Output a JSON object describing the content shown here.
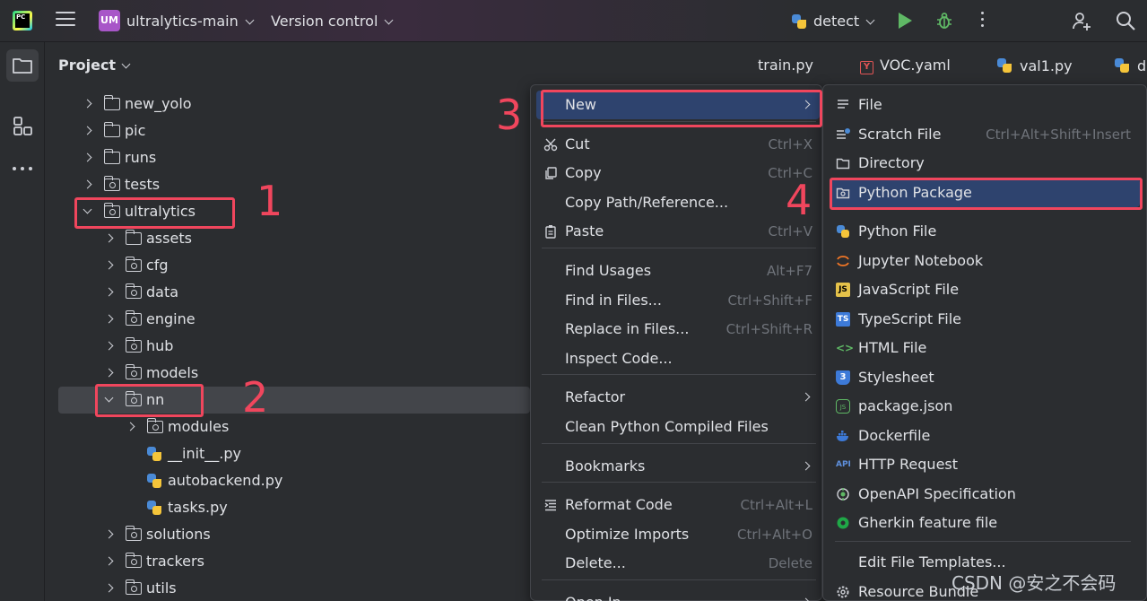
{
  "toolbar": {
    "logo_text": "PC",
    "project_badge": "UM",
    "project_name": "ultralytics-main",
    "vcs_label": "Version control",
    "run_config": "detect"
  },
  "project_panel": {
    "title": "Project",
    "tree": [
      {
        "label": "new_yolo",
        "kind": "folder",
        "expanded": false
      },
      {
        "label": "pic",
        "kind": "folder",
        "expanded": false
      },
      {
        "label": "runs",
        "kind": "folder",
        "expanded": false
      },
      {
        "label": "tests",
        "kind": "package",
        "expanded": false
      },
      {
        "label": "ultralytics",
        "kind": "package",
        "expanded": true
      },
      {
        "label": "assets",
        "kind": "folder",
        "expanded": false
      },
      {
        "label": "cfg",
        "kind": "package",
        "expanded": false
      },
      {
        "label": "data",
        "kind": "package",
        "expanded": false
      },
      {
        "label": "engine",
        "kind": "package",
        "expanded": false
      },
      {
        "label": "hub",
        "kind": "package",
        "expanded": false
      },
      {
        "label": "models",
        "kind": "package",
        "expanded": false
      },
      {
        "label": "nn",
        "kind": "package",
        "expanded": true,
        "selected": true
      },
      {
        "label": "modules",
        "kind": "package",
        "expanded": false
      },
      {
        "label": "__init__.py",
        "kind": "python"
      },
      {
        "label": "autobackend.py",
        "kind": "python"
      },
      {
        "label": "tasks.py",
        "kind": "python"
      },
      {
        "label": "solutions",
        "kind": "package",
        "expanded": false
      },
      {
        "label": "trackers",
        "kind": "package",
        "expanded": false
      },
      {
        "label": "utils",
        "kind": "package",
        "expanded": false
      }
    ]
  },
  "editor_tabs": [
    "train.py",
    "VOC.yaml",
    "val1.py",
    "d"
  ],
  "context_menu": {
    "items": [
      {
        "label": "New",
        "has_submenu": true,
        "highlighted": true
      },
      {
        "label": "Cut",
        "shortcut": "Ctrl+X",
        "icon": "scissors-icon"
      },
      {
        "label": "Copy",
        "shortcut": "Ctrl+C",
        "icon": "copy-icon"
      },
      {
        "label": "Copy Path/Reference..."
      },
      {
        "label": "Paste",
        "shortcut": "Ctrl+V",
        "icon": "paste-icon"
      },
      {
        "label": "Find Usages",
        "shortcut": "Alt+F7"
      },
      {
        "label": "Find in Files...",
        "shortcut": "Ctrl+Shift+F"
      },
      {
        "label": "Replace in Files...",
        "shortcut": "Ctrl+Shift+R"
      },
      {
        "label": "Inspect Code..."
      },
      {
        "label": "Refactor",
        "has_submenu": true
      },
      {
        "label": "Clean Python Compiled Files"
      },
      {
        "label": "Bookmarks",
        "has_submenu": true
      },
      {
        "label": "Reformat Code",
        "shortcut": "Ctrl+Alt+L",
        "icon": "reformat-icon"
      },
      {
        "label": "Optimize Imports",
        "shortcut": "Ctrl+Alt+O"
      },
      {
        "label": "Delete...",
        "shortcut": "Delete"
      },
      {
        "label": "Open In",
        "has_submenu": true
      }
    ]
  },
  "new_submenu": {
    "items": [
      {
        "label": "File",
        "icon": "file-lines-icon"
      },
      {
        "label": "Scratch File",
        "shortcut": "Ctrl+Alt+Shift+Insert",
        "icon": "scratch-file-icon"
      },
      {
        "label": "Directory",
        "icon": "folder-icon"
      },
      {
        "label": "Python Package",
        "icon": "python-package-icon",
        "highlighted": true
      },
      {
        "label": "Python File",
        "icon": "python-icon"
      },
      {
        "label": "Jupyter Notebook",
        "icon": "jupyter-icon"
      },
      {
        "label": "JavaScript File",
        "icon": "javascript-icon",
        "badge": "JS"
      },
      {
        "label": "TypeScript File",
        "icon": "typescript-icon",
        "badge": "TS"
      },
      {
        "label": "HTML File",
        "icon": "html-icon",
        "badge": "<>"
      },
      {
        "label": "Stylesheet",
        "icon": "css-icon",
        "badge": "3"
      },
      {
        "label": "package.json",
        "icon": "nodejs-icon",
        "badge": "JS"
      },
      {
        "label": "Dockerfile",
        "icon": "docker-icon"
      },
      {
        "label": "HTTP Request",
        "icon": "api-icon",
        "badge": "API"
      },
      {
        "label": "OpenAPI Specification",
        "icon": "openapi-icon"
      },
      {
        "label": "Gherkin feature file",
        "icon": "gherkin-icon"
      },
      {
        "label": "Edit File Templates..."
      },
      {
        "label": "Resource Bundle",
        "icon": "gear-icon"
      }
    ]
  },
  "annotations": [
    "1",
    "2",
    "3",
    "4"
  ],
  "watermark": "CSDN @安之不会码",
  "colors": {
    "accent_red": "#f0465d",
    "menu_highlight": "#2e436e",
    "background": "#2b2d30"
  }
}
